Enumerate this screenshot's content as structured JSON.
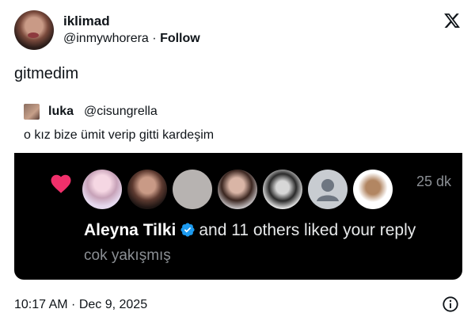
{
  "author": {
    "display_name": "iklimad",
    "handle": "@inmywhorera",
    "separator": "·",
    "follow_label": "Follow"
  },
  "header_icon": "x-logo-icon",
  "tweet": {
    "text": "gitmedim"
  },
  "quote": {
    "name": "luka",
    "handle": "@cisungrella",
    "text": "o kız bize ümit verip gitti kardeşim"
  },
  "media": {
    "time_ago": "25 dk",
    "heart_color": "#f0306b",
    "liker_name": "Aleyna Tilki",
    "liked_suffix": "and 11 others liked your reply",
    "reply_text": "cok yakışmış",
    "verified_color": "#1d9bf0",
    "liker_avatars": [
      "avatar-1",
      "avatar-2",
      "avatar-3",
      "avatar-4",
      "avatar-5",
      "avatar-6",
      "avatar-7"
    ]
  },
  "footer": {
    "timestamp": "10:17 AM · Dec 9, 2025",
    "info_icon": "info-icon"
  }
}
